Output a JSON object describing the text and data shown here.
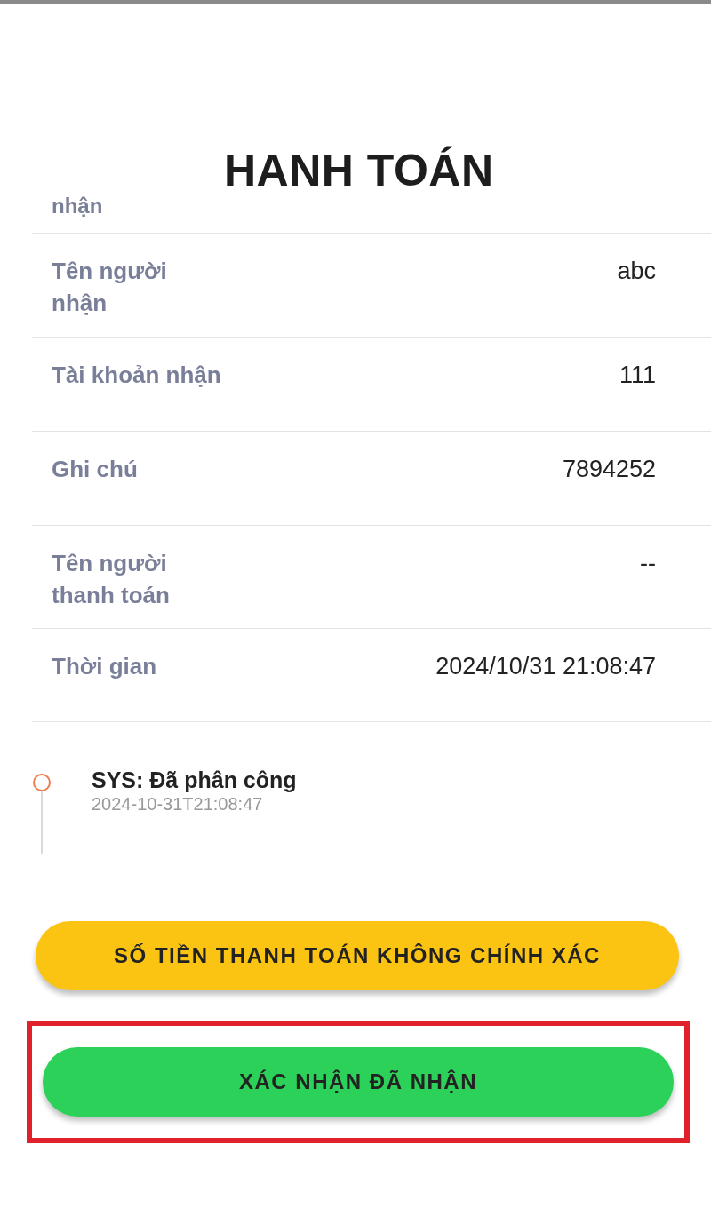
{
  "title": "HANH TOÁN",
  "cut_label": "nhận",
  "rows": [
    {
      "label": "Tên người\nnhận",
      "value": "abc"
    },
    {
      "label": "Tài khoản nhận",
      "value": "111"
    },
    {
      "label": "Ghi chú",
      "value": "7894252"
    },
    {
      "label": "Tên người\nthanh toán",
      "value": "--"
    },
    {
      "label": "Thời gian",
      "value": "2024/10/31 21:08:47"
    }
  ],
  "timeline": [
    {
      "title": "SYS: Đã phân công",
      "time": "2024-10-31T21:08:47"
    }
  ],
  "buttons": [
    {
      "label": "SỐ TIỀN THANH TOÁN KHÔNG CHÍNH XÁC",
      "kind": "warning",
      "highlighted": false
    },
    {
      "label": "XÁC NHẬN ĐÃ NHẬN",
      "kind": "confirm",
      "highlighted": true
    }
  ]
}
